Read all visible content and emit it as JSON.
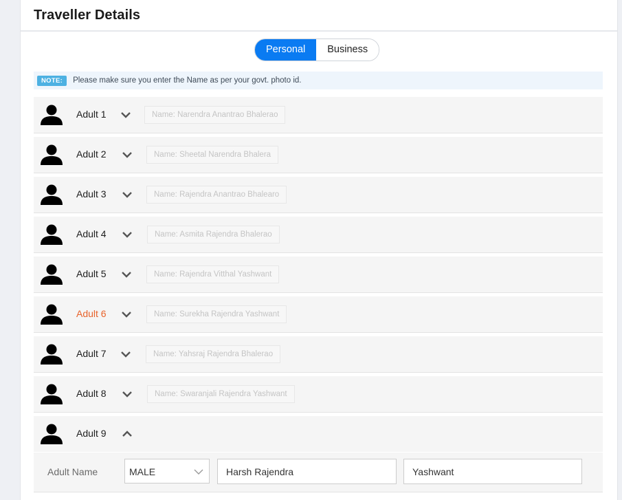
{
  "header": {
    "title": "Traveller Details"
  },
  "toggle": {
    "personal_label": "Personal",
    "business_label": "Business",
    "active": "Personal"
  },
  "note": {
    "tag": "NOTE:",
    "text": "Please make sure you enter the Name as per your govt. photo id."
  },
  "colors": {
    "accent": "#0a7bf2",
    "warning": "#e8622a",
    "note_tag": "#4db1e2"
  },
  "travellers": [
    {
      "label": "Adult 1",
      "name_hint": "Name: Narendra Anantrao Bhalerao",
      "expanded": false,
      "warning": false,
      "icon": "person-icon"
    },
    {
      "label": "Adult 2",
      "name_hint": "Name: Sheetal Narendra Bhalera",
      "expanded": false,
      "warning": false,
      "icon": "person-icon"
    },
    {
      "label": "Adult 3",
      "name_hint": "Name: Rajendra Anantrao Bhalearo",
      "expanded": false,
      "warning": false,
      "icon": "person-icon"
    },
    {
      "label": "Adult 4",
      "name_hint": "Name: Asmita Rajendra Bhalerao",
      "expanded": false,
      "warning": false,
      "icon": "person-icon"
    },
    {
      "label": "Adult 5",
      "name_hint": "Name: Rajendra Vitthal Yashwant",
      "expanded": false,
      "warning": false,
      "icon": "person-icon"
    },
    {
      "label": "Adult 6",
      "name_hint": "Name: Surekha Rajendra Yashwant",
      "expanded": false,
      "warning": true,
      "icon": "person-icon"
    },
    {
      "label": "Adult 7",
      "name_hint": "Name: Yahsraj Rajendra Bhalerao",
      "expanded": false,
      "warning": false,
      "icon": "person-icon"
    },
    {
      "label": "Adult 8",
      "name_hint": "Name: Swaranjali Rajendra Yashwant",
      "expanded": false,
      "warning": false,
      "icon": "person-icon"
    },
    {
      "label": "Adult 9",
      "name_hint": "",
      "expanded": true,
      "warning": false,
      "icon": "person-icon"
    }
  ],
  "expanded_form": {
    "label": "Adult Name",
    "gender": "MALE",
    "first_middle_name": "Harsh Rajendra",
    "last_name": "Yashwant"
  }
}
